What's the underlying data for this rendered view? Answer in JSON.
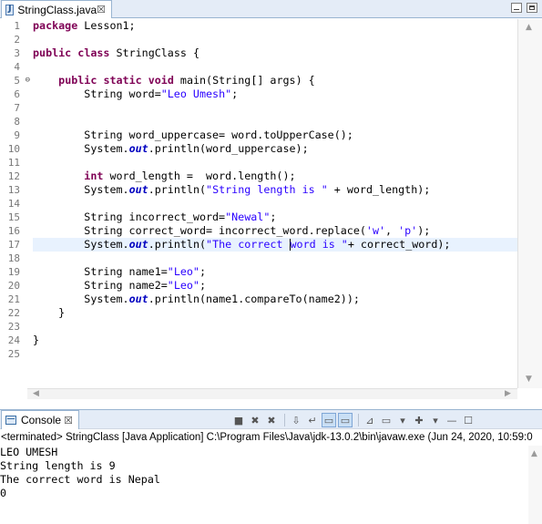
{
  "editor": {
    "tab_title": "StringClass.java",
    "tab_close": "☒",
    "lines": [
      {
        "n": "1",
        "parts": [
          {
            "t": "package",
            "c": "kw"
          },
          {
            "t": " Lesson1;",
            "c": ""
          }
        ]
      },
      {
        "n": "2",
        "parts": []
      },
      {
        "n": "3",
        "parts": [
          {
            "t": "public",
            "c": "kw"
          },
          {
            "t": " ",
            "c": ""
          },
          {
            "t": "class",
            "c": "kw"
          },
          {
            "t": " StringClass {",
            "c": ""
          }
        ]
      },
      {
        "n": "4",
        "parts": []
      },
      {
        "n": "5",
        "mark": true,
        "parts": [
          {
            "t": "    ",
            "c": ""
          },
          {
            "t": "public",
            "c": "kw"
          },
          {
            "t": " ",
            "c": ""
          },
          {
            "t": "static",
            "c": "kw"
          },
          {
            "t": " ",
            "c": ""
          },
          {
            "t": "void",
            "c": "kw"
          },
          {
            "t": " main(String[] args) {",
            "c": ""
          }
        ]
      },
      {
        "n": "6",
        "parts": [
          {
            "t": "        String word=",
            "c": ""
          },
          {
            "t": "\"Leo Umesh\"",
            "c": "str"
          },
          {
            "t": ";",
            "c": ""
          }
        ]
      },
      {
        "n": "7",
        "parts": []
      },
      {
        "n": "8",
        "parts": []
      },
      {
        "n": "9",
        "parts": [
          {
            "t": "        String word_uppercase= word.toUpperCase();",
            "c": ""
          }
        ]
      },
      {
        "n": "10",
        "parts": [
          {
            "t": "        System.",
            "c": ""
          },
          {
            "t": "out",
            "c": "fld"
          },
          {
            "t": ".println(word_uppercase);",
            "c": ""
          }
        ]
      },
      {
        "n": "11",
        "parts": []
      },
      {
        "n": "12",
        "parts": [
          {
            "t": "        ",
            "c": ""
          },
          {
            "t": "int",
            "c": "kw"
          },
          {
            "t": " word_length =  word.length();",
            "c": ""
          }
        ]
      },
      {
        "n": "13",
        "parts": [
          {
            "t": "        System.",
            "c": ""
          },
          {
            "t": "out",
            "c": "fld"
          },
          {
            "t": ".println(",
            "c": ""
          },
          {
            "t": "\"String length is \"",
            "c": "str"
          },
          {
            "t": " + word_length);",
            "c": ""
          }
        ]
      },
      {
        "n": "14",
        "parts": []
      },
      {
        "n": "15",
        "parts": [
          {
            "t": "        String incorrect_word=",
            "c": ""
          },
          {
            "t": "\"Newal\"",
            "c": "str"
          },
          {
            "t": ";",
            "c": ""
          }
        ]
      },
      {
        "n": "16",
        "parts": [
          {
            "t": "        String correct_word= incorrect_word.replace(",
            "c": ""
          },
          {
            "t": "'w'",
            "c": "str"
          },
          {
            "t": ", ",
            "c": ""
          },
          {
            "t": "'p'",
            "c": "str"
          },
          {
            "t": ");",
            "c": ""
          }
        ]
      },
      {
        "n": "17",
        "current": true,
        "parts": [
          {
            "t": "        System.",
            "c": ""
          },
          {
            "t": "out",
            "c": "fld"
          },
          {
            "t": ".println(",
            "c": ""
          },
          {
            "t": "\"The correct ",
            "c": "str"
          },
          {
            "t": "",
            "c": "caret"
          },
          {
            "t": "word is \"",
            "c": "str"
          },
          {
            "t": "+ correct_word);",
            "c": ""
          }
        ]
      },
      {
        "n": "18",
        "parts": []
      },
      {
        "n": "19",
        "parts": [
          {
            "t": "        String name1=",
            "c": ""
          },
          {
            "t": "\"Leo\"",
            "c": "str"
          },
          {
            "t": ";",
            "c": ""
          }
        ]
      },
      {
        "n": "20",
        "parts": [
          {
            "t": "        String name2=",
            "c": ""
          },
          {
            "t": "\"Leo\"",
            "c": "str"
          },
          {
            "t": ";",
            "c": ""
          }
        ]
      },
      {
        "n": "21",
        "parts": [
          {
            "t": "        System.",
            "c": ""
          },
          {
            "t": "out",
            "c": "fld"
          },
          {
            "t": ".println(name1.compareTo(name2));",
            "c": ""
          }
        ]
      },
      {
        "n": "22",
        "parts": [
          {
            "t": "    }",
            "c": ""
          }
        ]
      },
      {
        "n": "23",
        "parts": []
      },
      {
        "n": "24",
        "parts": [
          {
            "t": "}",
            "c": ""
          }
        ]
      },
      {
        "n": "25",
        "parts": []
      }
    ]
  },
  "console": {
    "tab_title": "Console",
    "tab_close": "☒",
    "status": "<terminated> StringClass [Java Application] C:\\Program Files\\Java\\jdk-13.0.2\\bin\\javaw.exe  (Jun 24, 2020, 10:59:0",
    "output": [
      "LEO UMESH",
      "String length is 9",
      "The correct word is Nepal",
      "0"
    ],
    "toolbar": [
      {
        "name": "terminate-icon",
        "glyph": "■"
      },
      {
        "name": "remove-launch-icon",
        "glyph": "✖"
      },
      {
        "name": "remove-all-terminated-icon",
        "glyph": "✖"
      },
      {
        "sep": true
      },
      {
        "name": "scroll-lock-icon",
        "glyph": "⇩"
      },
      {
        "name": "word-wrap-icon",
        "glyph": "↵"
      },
      {
        "name": "show-stdout-icon",
        "glyph": "▭",
        "sel": true
      },
      {
        "name": "show-stderr-icon",
        "glyph": "▭",
        "sel": true
      },
      {
        "sep": true
      },
      {
        "name": "pin-console-icon",
        "glyph": "⊿"
      },
      {
        "name": "display-console-icon",
        "glyph": "▭"
      },
      {
        "name": "display-console-dropdown-icon",
        "glyph": "▾"
      },
      {
        "name": "open-console-icon",
        "glyph": "✚"
      },
      {
        "name": "open-console-dropdown-icon",
        "glyph": "▾"
      },
      {
        "name": "view-minimize-icon",
        "glyph": "—"
      },
      {
        "name": "view-maximize-icon",
        "glyph": "☐"
      }
    ]
  }
}
